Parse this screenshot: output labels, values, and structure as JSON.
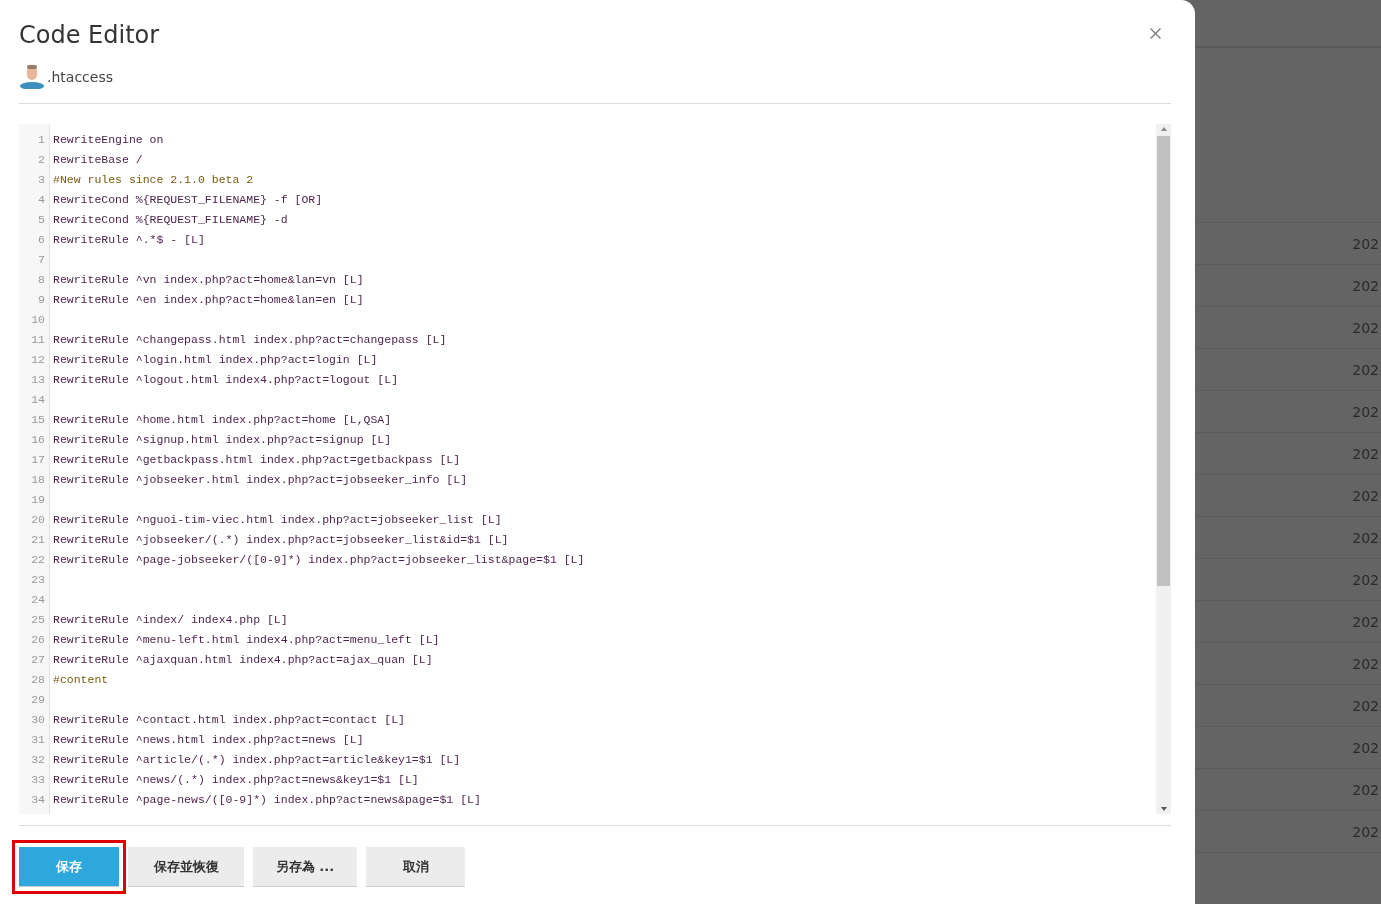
{
  "dialog": {
    "title": "Code Editor",
    "file_name": ".htaccess"
  },
  "editor": {
    "lines": [
      {
        "number": "1",
        "kind": "code",
        "text": "RewriteEngine on"
      },
      {
        "number": "2",
        "kind": "code",
        "text": "RewriteBase /"
      },
      {
        "number": "3",
        "kind": "comment",
        "text": "#New rules since 2.1.0 beta 2"
      },
      {
        "number": "4",
        "kind": "code",
        "text": "RewriteCond %{REQUEST_FILENAME} -f [OR]"
      },
      {
        "number": "5",
        "kind": "code",
        "text": "RewriteCond %{REQUEST_FILENAME} -d"
      },
      {
        "number": "6",
        "kind": "code",
        "text": "RewriteRule ^.*$ - [L]"
      },
      {
        "number": "7",
        "kind": "blank"
      },
      {
        "number": "8",
        "kind": "code",
        "text": "RewriteRule ^vn index.php?act=home&lan=vn [L]"
      },
      {
        "number": "9",
        "kind": "code",
        "text": "RewriteRule ^en index.php?act=home&lan=en [L]"
      },
      {
        "number": "10",
        "kind": "blank"
      },
      {
        "number": "11",
        "kind": "code",
        "text": "RewriteRule ^changepass.html index.php?act=changepass [L]"
      },
      {
        "number": "12",
        "kind": "code",
        "text": "RewriteRule ^login.html index.php?act=login [L]"
      },
      {
        "number": "13",
        "kind": "code",
        "text": "RewriteRule ^logout.html index4.php?act=logout [L]"
      },
      {
        "number": "14",
        "kind": "blank"
      },
      {
        "number": "15",
        "kind": "code",
        "text": "RewriteRule ^home.html index.php?act=home [L,QSA]"
      },
      {
        "number": "16",
        "kind": "code",
        "text": "RewriteRule ^signup.html index.php?act=signup [L]"
      },
      {
        "number": "17",
        "kind": "code",
        "text": "RewriteRule ^getbackpass.html index.php?act=getbackpass [L]"
      },
      {
        "number": "18",
        "kind": "code",
        "text": "RewriteRule ^jobseeker.html index.php?act=jobseeker_info [L]"
      },
      {
        "number": "19",
        "kind": "blank"
      },
      {
        "number": "20",
        "kind": "code",
        "text": "RewriteRule ^nguoi-tim-viec.html index.php?act=jobseeker_list [L]"
      },
      {
        "number": "21",
        "kind": "code",
        "text": "RewriteRule ^jobseeker/(.*) index.php?act=jobseeker_list&id=$1 [L]"
      },
      {
        "number": "22",
        "kind": "code",
        "text": "RewriteRule ^page-jobseeker/([0-9]*) index.php?act=jobseeker_list&page=$1 [L]"
      },
      {
        "number": "23",
        "kind": "blank"
      },
      {
        "number": "24",
        "kind": "blank"
      },
      {
        "number": "25",
        "kind": "code",
        "text": "RewriteRule ^index/ index4.php [L]"
      },
      {
        "number": "26",
        "kind": "code",
        "text": "RewriteRule ^menu-left.html index4.php?act=menu_left [L]"
      },
      {
        "number": "27",
        "kind": "code",
        "text": "RewriteRule ^ajaxquan.html index4.php?act=ajax_quan [L]"
      },
      {
        "number": "28",
        "kind": "comment",
        "text": "#content"
      },
      {
        "number": "29",
        "kind": "blank"
      },
      {
        "number": "30",
        "kind": "code",
        "text": "RewriteRule ^contact.html index.php?act=contact [L]"
      },
      {
        "number": "31",
        "kind": "code",
        "text": "RewriteRule ^news.html index.php?act=news [L]"
      },
      {
        "number": "32",
        "kind": "code",
        "text": "RewriteRule ^article/(.*) index.php?act=article&key1=$1 [L]"
      },
      {
        "number": "33",
        "kind": "code",
        "text": "RewriteRule ^news/(.*) index.php?act=news&key1=$1 [L]"
      },
      {
        "number": "34",
        "kind": "code",
        "text": "RewriteRule ^page-news/([0-9]*) index.php?act=news&page=$1 [L]"
      }
    ]
  },
  "buttons": [
    {
      "label": "保存",
      "selected": true,
      "highlighted": true
    },
    {
      "label": "保存並恢復",
      "selected": false,
      "highlighted": false
    },
    {
      "label": "另存為 ...",
      "selected": false,
      "highlighted": false
    },
    {
      "label": "取消",
      "selected": false,
      "highlighted": false
    }
  ],
  "background_rows": [
    "202",
    "202",
    "202",
    "202",
    "202",
    "202",
    "202",
    "202",
    "202",
    "202",
    "202",
    "202",
    "202",
    "202",
    "202"
  ]
}
